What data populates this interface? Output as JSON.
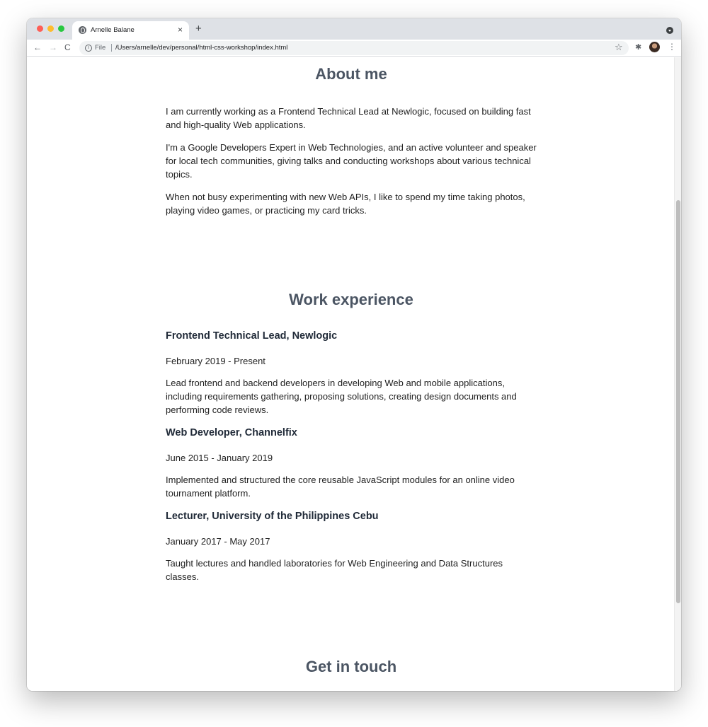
{
  "browser": {
    "tab_title": "Arnelle Balane",
    "tab_close": "×",
    "new_tab": "+",
    "scheme_label": "File",
    "url": "/Users/arnelle/dev/personal/html-css-workshop/index.html",
    "back_glyph": "←",
    "forward_glyph": "→",
    "reload_glyph": "C",
    "star_glyph": "☆",
    "extensions_glyph": "✱",
    "menu_glyph": "⋮",
    "info_glyph": "i",
    "icons": [
      "globe-icon",
      "close-icon",
      "plus-icon",
      "back-icon",
      "forward-icon",
      "reload-icon",
      "info-icon",
      "star-icon",
      "puzzle-icon",
      "profile-icon",
      "menu-icon"
    ]
  },
  "about": {
    "heading": "About me",
    "paragraphs": [
      "I am currently working as a Frontend Technical Lead at Newlogic, focused on building fast and high-quality Web applications.",
      "I'm a Google Developers Expert in Web Technologies, and an active volunteer and speaker for local tech communities, giving talks and conducting workshops about various technical topics.",
      "When not busy experimenting with new Web APIs, I like to spend my time taking photos, playing video games, or practicing my card tricks."
    ]
  },
  "work": {
    "heading": "Work experience",
    "jobs": [
      {
        "title": "Frontend Technical Lead, Newlogic",
        "dates": "February 2019 - Present",
        "description": "Lead frontend and backend developers in developing Web and mobile applications, including requirements gathering, proposing solutions, creating design documents and performing code reviews."
      },
      {
        "title": "Web Developer, Channelfix",
        "dates": "June 2015 - January 2019",
        "description": "Implemented and structured the core reusable JavaScript modules for an online video tournament platform."
      },
      {
        "title": "Lecturer, University of the Philippines Cebu",
        "dates": "January 2017 - May 2017",
        "description": "Taught lectures and handled laboratories for Web Engineering and Data Structures classes."
      }
    ]
  },
  "contact": {
    "heading": "Get in touch"
  },
  "colors": {
    "heading": "#4b5563",
    "body_text": "#1f1f1f",
    "tabstrip": "#dee1e6"
  }
}
